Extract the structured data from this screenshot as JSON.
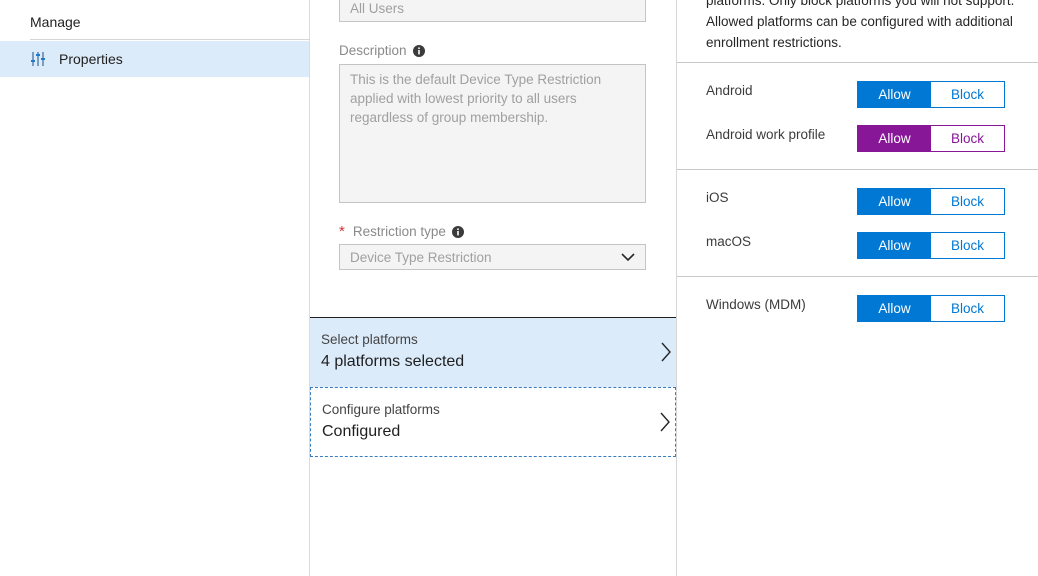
{
  "left_nav": {
    "section_title": "Manage",
    "items": [
      {
        "label": "Properties",
        "icon": "properties-sliders-icon"
      }
    ]
  },
  "middle": {
    "top_field_value": "All Users",
    "description": {
      "label": "Description",
      "value": "This is the default Device Type Restriction applied with lowest priority to all users regardless of group membership."
    },
    "restriction_type": {
      "required_marker": "*",
      "label": "Restriction type",
      "value": "Device Type Restriction"
    },
    "rows": [
      {
        "title": "Select platforms",
        "value": "4 platforms selected"
      },
      {
        "title": "Configure platforms",
        "value": "Configured"
      }
    ]
  },
  "right": {
    "intro": "platforms. Only block platforms you will not support. Allowed platforms can be configured with additional enrollment restrictions.",
    "platforms": [
      {
        "name": "Android",
        "allow": "Allow",
        "block": "Block",
        "selected": "Allow"
      },
      {
        "name": "Android work profile",
        "allow": "Allow",
        "block": "Block",
        "selected": "Allow"
      },
      {
        "name": "iOS",
        "allow": "Allow",
        "block": "Block",
        "selected": "Allow"
      },
      {
        "name": "macOS",
        "allow": "Allow",
        "block": "Block",
        "selected": "Allow"
      },
      {
        "name": "Windows (MDM)",
        "allow": "Allow",
        "block": "Block",
        "selected": "Allow"
      }
    ]
  },
  "colors": {
    "accent": "#0078d4",
    "accent_purple": "#881798",
    "selected_row_bg": "#dcebfa",
    "required": "#d13438"
  }
}
